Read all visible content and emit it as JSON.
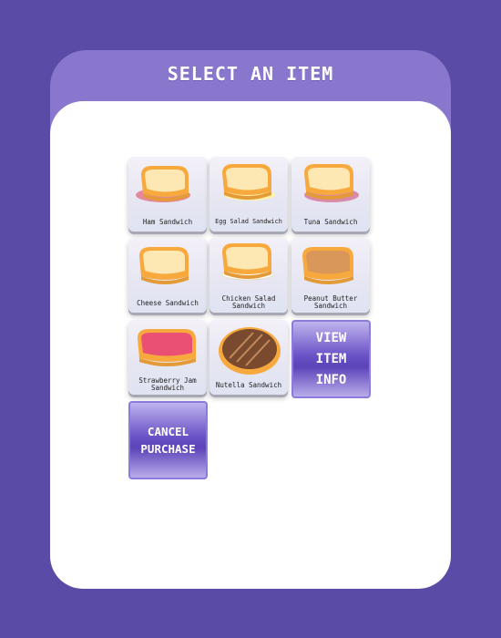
{
  "dialog": {
    "title": "SELECT AN ITEM"
  },
  "items": [
    {
      "label": "Ham Sandwich",
      "icon": "ham-sandwich-icon"
    },
    {
      "label": "Egg Salad Sandwich",
      "icon": "egg-salad-sandwich-icon"
    },
    {
      "label": "Tuna Sandwich",
      "icon": "tuna-sandwich-icon"
    },
    {
      "label": "Cheese Sandwich",
      "icon": "cheese-sandwich-icon"
    },
    {
      "label": "Chicken Salad\nSandwich",
      "icon": "chicken-salad-sandwich-icon"
    },
    {
      "label": "Peanut Butter\nSandwich",
      "icon": "peanut-butter-sandwich-icon"
    },
    {
      "label": "Strawberry Jam\nSandwich",
      "icon": "strawberry-jam-sandwich-icon"
    },
    {
      "label": "Nutella Sandwich",
      "icon": "nutella-sandwich-icon"
    }
  ],
  "buttons": {
    "view_info": "VIEW\nITEM\nINFO",
    "cancel": "CANCEL\nPURCHASE"
  },
  "colors": {
    "background": "#5a4ca6",
    "header": "#8877cc",
    "button": "#5b43b8"
  }
}
